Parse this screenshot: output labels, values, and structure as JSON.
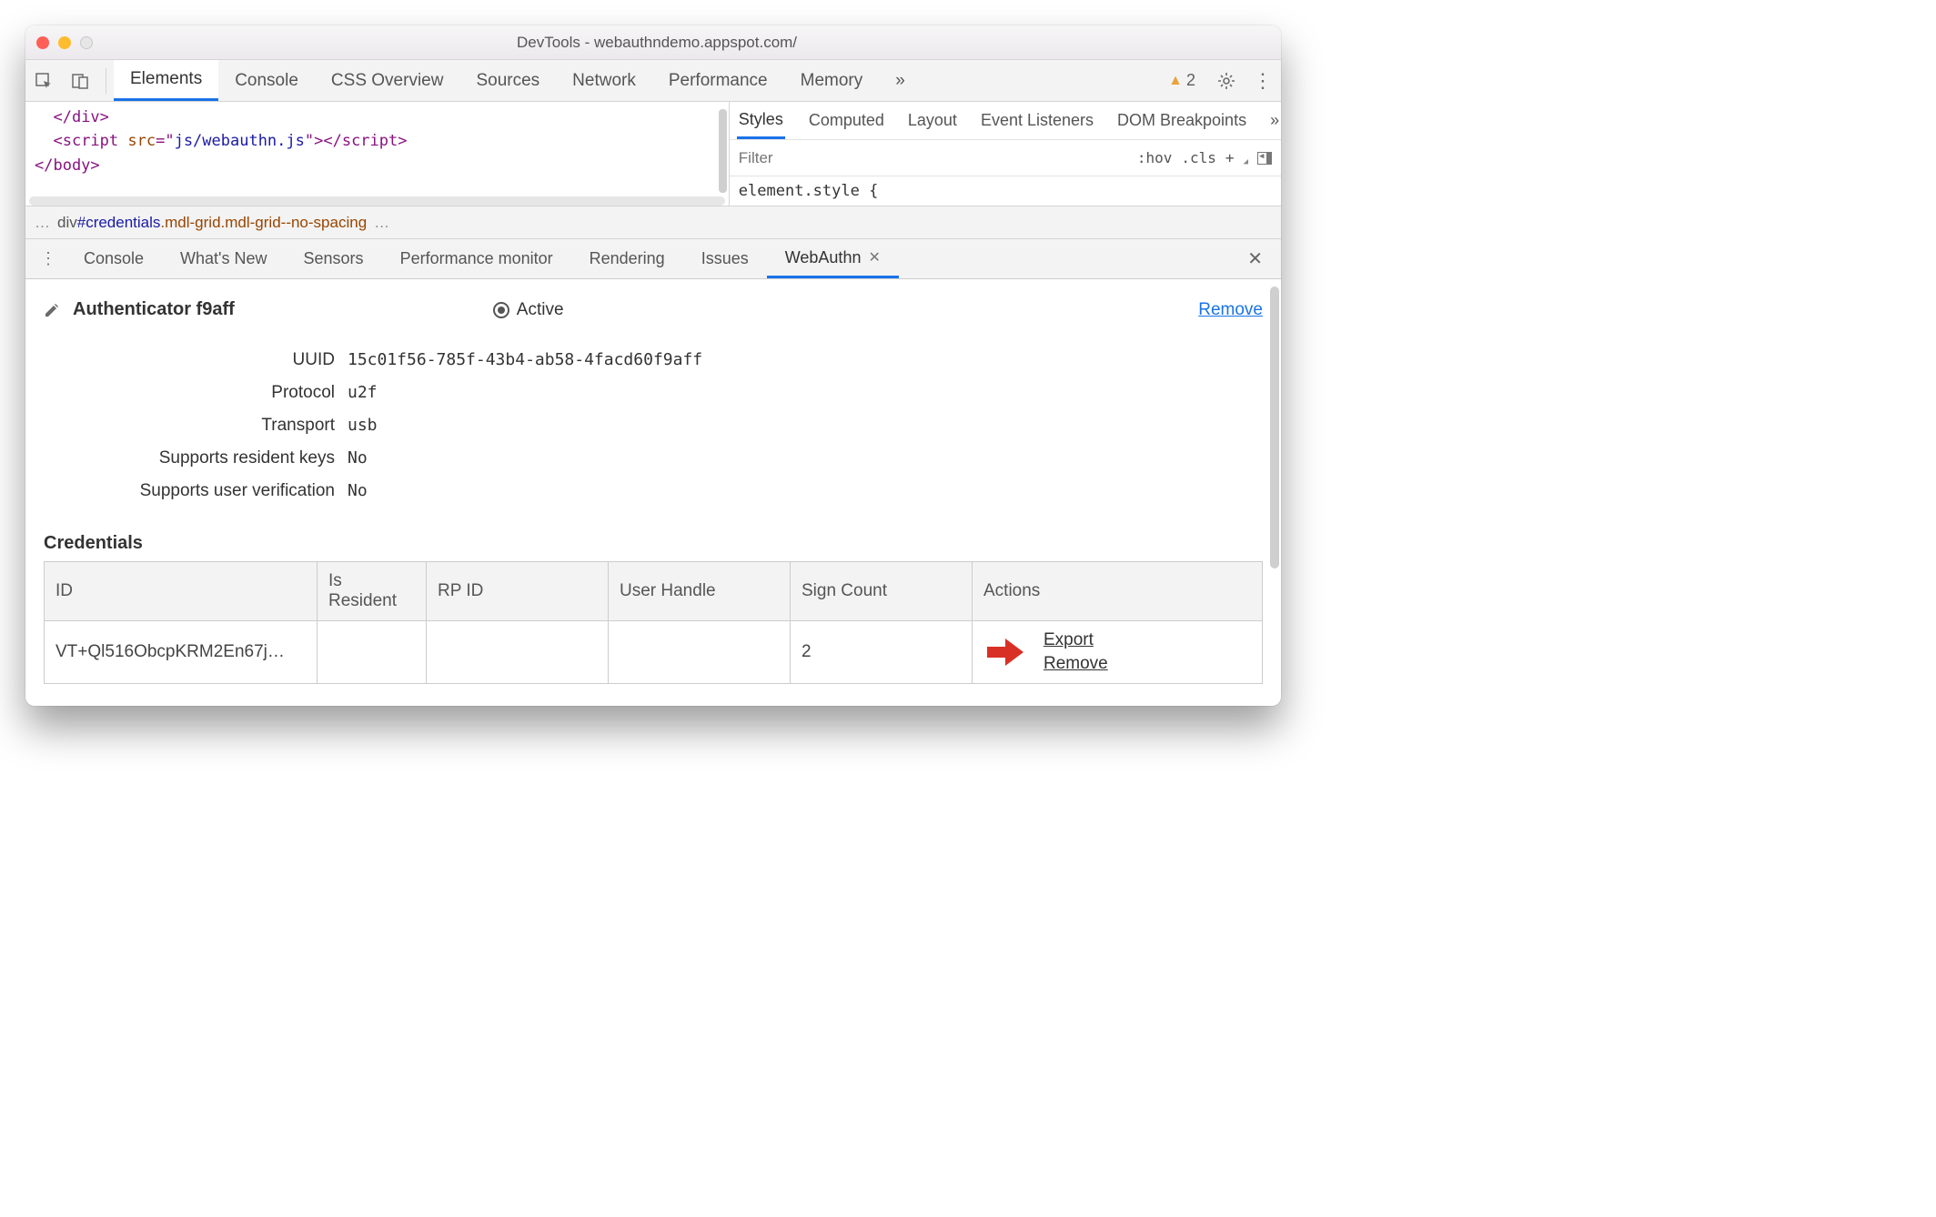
{
  "titlebar": {
    "title": "DevTools - webauthndemo.appspot.com/"
  },
  "main_tabs": {
    "items": [
      "Elements",
      "Console",
      "CSS Overview",
      "Sources",
      "Network",
      "Performance",
      "Memory"
    ],
    "active": 0,
    "warning_count": "2"
  },
  "code": {
    "line1_close": "</div>",
    "line2_open": "<script ",
    "line2_attr": "src",
    "line2_eq": "=\"",
    "line2_val": "js/webauthn.js",
    "line2_closeq": "\">",
    "line2_end": "</script>",
    "line3": "</body>"
  },
  "breadcrumb": {
    "left_dots": "…",
    "element": "div",
    "id": "#credentials",
    "classes": ".mdl-grid.mdl-grid--no-spacing",
    "right_dots": "…"
  },
  "styles_tabs": [
    "Styles",
    "Computed",
    "Layout",
    "Event Listeners",
    "DOM Breakpoints"
  ],
  "styles_filter": {
    "placeholder": "Filter",
    "hov": ":hov",
    "cls": ".cls",
    "add": "+"
  },
  "element_style_line": "element.style {",
  "drawer_tabs": {
    "items": [
      "Console",
      "What's New",
      "Sensors",
      "Performance monitor",
      "Rendering",
      "Issues",
      "WebAuthn"
    ],
    "active": 6
  },
  "authenticator": {
    "title": "Authenticator f9aff",
    "active_label": "Active",
    "remove_label": "Remove",
    "props": {
      "uuid_label": "UUID",
      "uuid": "15c01f56-785f-43b4-ab58-4facd60f9aff",
      "protocol_label": "Protocol",
      "protocol": "u2f",
      "transport_label": "Transport",
      "transport": "usb",
      "resident_label": "Supports resident keys",
      "resident": "No",
      "uv_label": "Supports user verification",
      "uv": "No"
    }
  },
  "credentials": {
    "heading": "Credentials",
    "headers": {
      "id": "ID",
      "resident": "Is Resident",
      "rpid": "RP ID",
      "handle": "User Handle",
      "sign": "Sign Count",
      "actions": "Actions"
    },
    "row": {
      "id": "VT+Ql516ObcpKRM2En67j…",
      "resident": "",
      "rpid": "",
      "handle": "",
      "sign": "2",
      "export": "Export",
      "remove": "Remove"
    }
  }
}
